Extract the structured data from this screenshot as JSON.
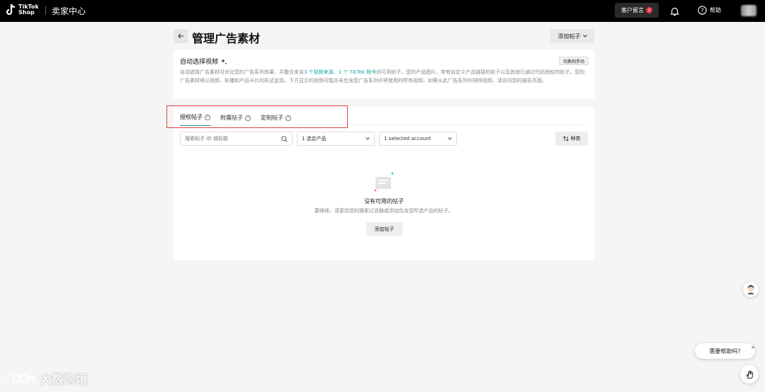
{
  "topbar": {
    "logo_line1": "TikTok",
    "logo_line2": "Shop",
    "seller_center": "卖家中心",
    "customer_message": "客户留言",
    "customer_badge": "2",
    "help": "帮助"
  },
  "header": {
    "title": "管理广告素材",
    "add_post": "添加帖子"
  },
  "auto_select": {
    "title": "自动选择视频",
    "switch_label": "切换到手动",
    "desc_part1": "自动选择广告素材可优化您的广告系列效果，并整合来自",
    "desc_link1": "3 个视频来源",
    "desc_part2": "、",
    "desc_link2": "1 个 TikTok 账号",
    "desc_part3": "的可用帖子、您的产品图片、带有自定义产品链接的帖子以及其他已通过代码授权的帖子。您的广告素材将以视频、轮播和产品卡片的形式呈现。下方显示的视频可能并未包含您广告系列中将使用的所有视频。如需从此广告系列中排除视频，请访问您的报告页面。"
  },
  "tabs": [
    {
      "label": "授权帖子",
      "active": true
    },
    {
      "label": "附属帖子",
      "active": false
    },
    {
      "label": "定制帖子",
      "active": false
    }
  ],
  "filters": {
    "search_placeholder": "搜索帖子 ID 或标题",
    "product_select": "1 选定产品",
    "account_select": "1 selected account",
    "sort_label": "种类"
  },
  "empty_state": {
    "title": "没有可用的帖子",
    "desc": "要继续，请更改您的搜索过滤器或添加包含您所选产品的帖子。",
    "button": "添加帖子"
  },
  "help_widget": {
    "bubble": "需要帮助吗?",
    "close": "×"
  },
  "watermark": {
    "text": "大数跨境"
  },
  "colors": {
    "accent": "#19a3a0",
    "highlight": "#d9463c",
    "badge": "#e5334a"
  }
}
